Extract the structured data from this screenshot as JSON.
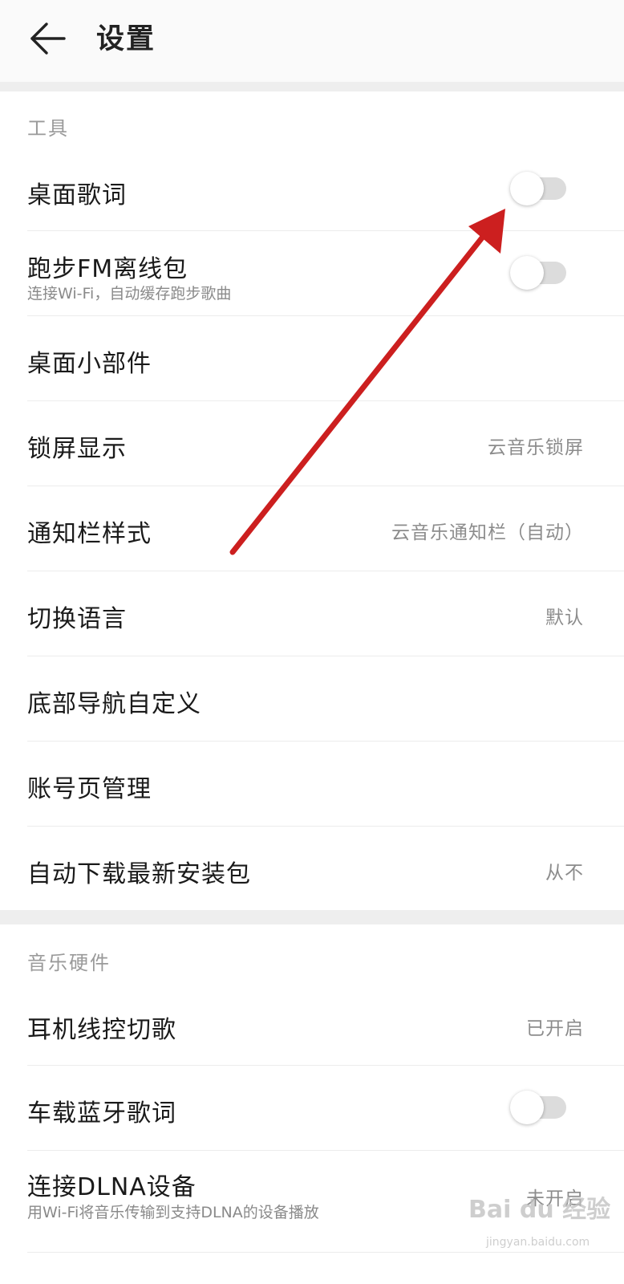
{
  "header": {
    "title": "设置",
    "back_icon": "arrow-left-icon"
  },
  "sections": {
    "tools": {
      "title": "工具",
      "items": {
        "desktop_lyrics": {
          "label": "桌面歌词",
          "toggle_on": false
        },
        "running_fm": {
          "label": "跑步FM离线包",
          "sub": "连接Wi-Fi，自动缓存跑步歌曲",
          "toggle_on": false
        },
        "desktop_widget": {
          "label": "桌面小部件"
        },
        "lock_screen": {
          "label": "锁屏显示",
          "value": "云音乐锁屏"
        },
        "notification_style": {
          "label": "通知栏样式",
          "value": "云音乐通知栏（自动）"
        },
        "language": {
          "label": "切换语言",
          "value": "默认"
        },
        "bottom_nav": {
          "label": "底部导航自定义"
        },
        "account_page": {
          "label": "账号页管理"
        },
        "auto_download": {
          "label": "自动下载最新安装包",
          "value": "从不"
        }
      }
    },
    "hardware": {
      "title": "音乐硬件",
      "items": {
        "headset_control": {
          "label": "耳机线控切歌",
          "value": "已开启"
        },
        "car_bluetooth": {
          "label": "车载蓝牙歌词",
          "toggle_on": false
        },
        "dlna": {
          "label": "连接DLNA设备",
          "sub": "用Wi-Fi将音乐传输到支持DLNA的设备播放",
          "value": "未开启"
        }
      }
    }
  },
  "annotation": {
    "arrow_color": "#cc1f1f",
    "arrow_icon": "red-arrow-annotation"
  },
  "watermark": {
    "text": "Bai du 经验",
    "sub": "jingyan.baidu.com"
  },
  "colors": {
    "text_primary": "#1a1a1a",
    "text_secondary": "#8c8c8c",
    "section_title": "#9a9a9a",
    "toggle_track_off": "#dcdcdc",
    "band": "#eeeeee"
  }
}
